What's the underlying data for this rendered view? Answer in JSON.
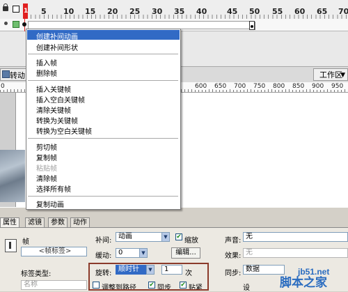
{
  "timeline": {
    "frame_numbers": [
      "5",
      "10",
      "15",
      "20",
      "25",
      "30",
      "35",
      "40",
      "45",
      "50",
      "55",
      "60",
      "65",
      "70"
    ],
    "current_frame": "1"
  },
  "scene": {
    "label": "转动",
    "workspace_label": "工作区"
  },
  "ruler": {
    "labels": [
      "0",
      "600",
      "650",
      "700",
      "750",
      "800",
      "850",
      "900",
      "950"
    ]
  },
  "context_menu": {
    "items": [
      {
        "label": "创建补间动画",
        "highlighted": true
      },
      {
        "label": "创建补间形状"
      },
      {
        "separator": true
      },
      {
        "label": "插入帧"
      },
      {
        "label": "删除帧"
      },
      {
        "separator": true
      },
      {
        "label": "插入关键帧"
      },
      {
        "label": "插入空白关键帧"
      },
      {
        "label": "清除关键帧"
      },
      {
        "label": "转换为关键帧"
      },
      {
        "label": "转换为空白关键帧"
      },
      {
        "separator": true
      },
      {
        "label": "剪切帧"
      },
      {
        "label": "复制帧"
      },
      {
        "label": "粘贴帧",
        "disabled": true
      },
      {
        "label": "清除帧"
      },
      {
        "label": "选择所有帧"
      },
      {
        "separator": true
      },
      {
        "label": "复制动画"
      }
    ]
  },
  "properties": {
    "tabs": [
      "属性",
      "滤镜",
      "参数",
      "动作"
    ],
    "frame_label": "帧",
    "frame_name_placeholder": "<帧标签>",
    "label_type_label": "标签类型:",
    "label_type_value": "名称",
    "tween_label": "补间:",
    "tween_value": "动画",
    "scale_label": "缩放",
    "ease_label": "缓动:",
    "ease_value": "0",
    "edit_button": "编辑...",
    "rotate_label": "旋转:",
    "rotate_value": "顺时针",
    "rotate_count": "1",
    "rotate_unit": "次",
    "orient_to_path_label": "调整到路径",
    "sync_label": "同步",
    "snap_label": "贴紧",
    "sound_label": "声音:",
    "sound_value": "无",
    "effect_label": "效果:",
    "effect_value": "无",
    "sync_sound_label": "同步:",
    "sync_sound_value": "数据",
    "set_label": "设"
  },
  "watermark": {
    "site": "jb51.net",
    "brand": "脚本之家"
  },
  "colors": {
    "menu_highlight": "#316ac5",
    "playhead": "#e12020",
    "annotation_box": "#8b3a2a",
    "watermark": "#2a6cc0"
  }
}
